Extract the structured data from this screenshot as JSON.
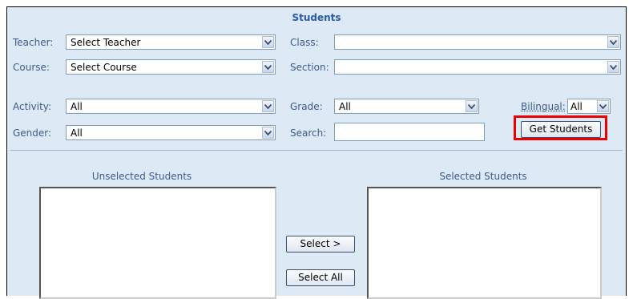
{
  "form": {
    "title": "Students",
    "teacher": {
      "label": "Teacher:",
      "value": "Select Teacher"
    },
    "course": {
      "label": "Course:",
      "value": "Select Course"
    },
    "class": {
      "label": "Class:",
      "value": ""
    },
    "section": {
      "label": "Section:",
      "value": ""
    },
    "activity": {
      "label": "Activity:",
      "value": "All"
    },
    "gender": {
      "label": "Gender:",
      "value": "All"
    },
    "grade": {
      "label": "Grade:",
      "value": "All"
    },
    "search": {
      "label": "Search:",
      "value": ""
    },
    "bilingual": {
      "label": "Bilingual:",
      "value": "All"
    },
    "get_students_label": "Get Students"
  },
  "lists": {
    "unselected_title": "Unselected Students",
    "selected_title": "Selected Students",
    "select_label": "Select >",
    "select_all_label": "Select All"
  },
  "icons": {
    "dropdown": "chevron-down-icon"
  },
  "colors": {
    "highlight": "#ee0000",
    "panel_bg": "#dde9f5",
    "title": "#2d5aa8"
  }
}
